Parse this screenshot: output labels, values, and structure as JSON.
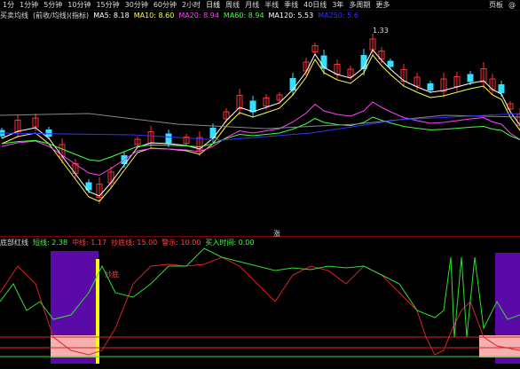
{
  "toolbar": {
    "items": [
      "1分",
      "1分钟",
      "5分钟",
      "10分钟",
      "15分钟",
      "30分钟",
      "60分钟",
      "2小时",
      "日线",
      "周线",
      "月线",
      "半线",
      "季线",
      "40日线",
      "3年",
      "多周期"
    ],
    "more": "更多",
    "right_items": [
      "页板",
      "@"
    ]
  },
  "main_legend": {
    "indicator": "买卖均线",
    "extra": "(前收/均线)(指标)",
    "ma5": "MA5: 8.18",
    "ma10": "MA10: 8.60",
    "ma20": "MA20: 8.94",
    "ma60": "MA60: 8.94",
    "ma120": "MA120: 5.53",
    "ma250": "MA250: 5.6"
  },
  "price_annotation": "1.33",
  "sub_legend": {
    "name": "底部红线",
    "l1": "短线: 2.38",
    "l2": "中线: 1.17",
    "l3": "抄底线: 15.00",
    "l4": "警示: 10.00",
    "l5": "买入时间: 0.00"
  },
  "sub_annotation": "抄底",
  "mid_label": "涨",
  "colors": {
    "up": "#ff3333",
    "down": "#33e0ff",
    "ma5": "#ffffff",
    "ma10": "#ffff44",
    "ma20": "#ff44ff",
    "ma60": "#44ff44",
    "ma120": "#3333ff",
    "ma250": "#888888",
    "purple": "#5a0aa6",
    "pink": "#f5b0b0",
    "yellow": "#ffff00",
    "green_line": "#33dd33",
    "red_line": "#dd2222"
  }
}
